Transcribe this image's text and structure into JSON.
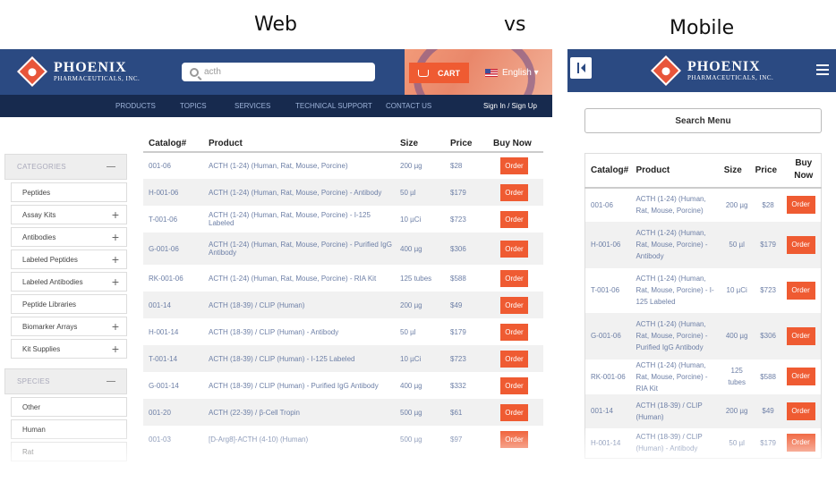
{
  "captions": {
    "web": "Web",
    "vs": "vs",
    "mobile": "Mobile"
  },
  "brand": {
    "name": "PHOENIX",
    "sub": "PHARMACEUTICALS, INC."
  },
  "web": {
    "search_value": "acth",
    "cart_label": "CART",
    "language": "English ▾",
    "nav": [
      "PRODUCTS",
      "TOPICS",
      "SERVICES",
      "TECHNICAL SUPPORT",
      "CONTACT US"
    ],
    "signin": "Sign In / Sign Up",
    "sidebar": {
      "categories_label": "CATEGORIES",
      "categories": [
        {
          "label": "Peptides",
          "expand": false
        },
        {
          "label": "Assay Kits",
          "expand": true
        },
        {
          "label": "Antibodies",
          "expand": true
        },
        {
          "label": "Labeled Peptides",
          "expand": true
        },
        {
          "label": "Labeled Antibodies",
          "expand": true
        },
        {
          "label": "Peptide Libraries",
          "expand": false
        },
        {
          "label": "Biomarker Arrays",
          "expand": true
        },
        {
          "label": "Kit Supplies",
          "expand": true
        }
      ],
      "species_label": "SPECIES",
      "species": [
        "Other",
        "Human",
        "Rat"
      ]
    },
    "table": {
      "headers": [
        "Catalog#",
        "Product",
        "Size",
        "Price",
        "Buy Now"
      ],
      "order_label": "Order",
      "rows": [
        {
          "catalog": "001-06",
          "product": "ACTH (1-24) (Human, Rat, Mouse, Porcine)",
          "size": "200 µg",
          "price": "$28"
        },
        {
          "catalog": "H-001-06",
          "product": "ACTH (1-24) (Human, Rat, Mouse, Porcine) - Antibody",
          "size": "50 µl",
          "price": "$179"
        },
        {
          "catalog": "T-001-06",
          "product": "ACTH (1-24) (Human, Rat, Mouse, Porcine) - I-125 Labeled",
          "size": "10 µCi",
          "price": "$723"
        },
        {
          "catalog": "G-001-06",
          "product": "ACTH (1-24) (Human, Rat, Mouse, Porcine) - Purified IgG Antibody",
          "size": "400 µg",
          "price": "$306"
        },
        {
          "catalog": "RK-001-06",
          "product": "ACTH (1-24) (Human, Rat, Mouse, Porcine) - RIA Kit",
          "size": "125 tubes",
          "price": "$588"
        },
        {
          "catalog": "001-14",
          "product": "ACTH (18-39) / CLIP (Human)",
          "size": "200 µg",
          "price": "$49"
        },
        {
          "catalog": "H-001-14",
          "product": "ACTH (18-39) / CLIP (Human) - Antibody",
          "size": "50 µl",
          "price": "$179"
        },
        {
          "catalog": "T-001-14",
          "product": "ACTH (18-39) / CLIP (Human) - I-125 Labeled",
          "size": "10 µCi",
          "price": "$723"
        },
        {
          "catalog": "G-001-14",
          "product": "ACTH (18-39) / CLIP (Human) - Purified IgG Antibody",
          "size": "400 µg",
          "price": "$332"
        },
        {
          "catalog": "001-20",
          "product": "ACTH (22-39) / β-Cell Tropin",
          "size": "500 µg",
          "price": "$61"
        },
        {
          "catalog": "001-03",
          "product": "[D-Arg8]-ACTH (4-10) (Human)",
          "size": "500 µg",
          "price": "$97"
        }
      ]
    }
  },
  "mobile": {
    "search_menu": "Search Menu",
    "headers": [
      "Catalog#",
      "Product",
      "Size",
      "Price",
      "Buy Now"
    ],
    "order_label": "Order",
    "rows": [
      {
        "catalog": "001-06",
        "product": "ACTH (1-24) (Human, Rat, Mouse, Porcine)",
        "size": "200 µg",
        "price": "$28"
      },
      {
        "catalog": "H-001-06",
        "product": "ACTH (1-24) (Human, Rat, Mouse, Porcine) - Antibody",
        "size": "50 µl",
        "price": "$179"
      },
      {
        "catalog": "T-001-06",
        "product": "ACTH (1-24) (Human, Rat, Mouse, Porcine) - I-125 Labeled",
        "size": "10 µCi",
        "price": "$723"
      },
      {
        "catalog": "G-001-06",
        "product": "ACTH (1-24) (Human, Rat, Mouse, Porcine) - Purified IgG Antibody",
        "size": "400 µg",
        "price": "$306"
      },
      {
        "catalog": "RK-001-06",
        "product": "ACTH (1-24) (Human, Rat, Mouse, Porcine) - RIA Kit",
        "size": "125 tubes",
        "price": "$588"
      },
      {
        "catalog": "001-14",
        "product": "ACTH (18-39) / CLIP (Human)",
        "size": "200 µg",
        "price": "$49"
      },
      {
        "catalog": "H-001-14",
        "product": "ACTH (18-39) / CLIP (Human) - Antibody",
        "size": "50 µl",
        "price": "$179"
      }
    ]
  }
}
